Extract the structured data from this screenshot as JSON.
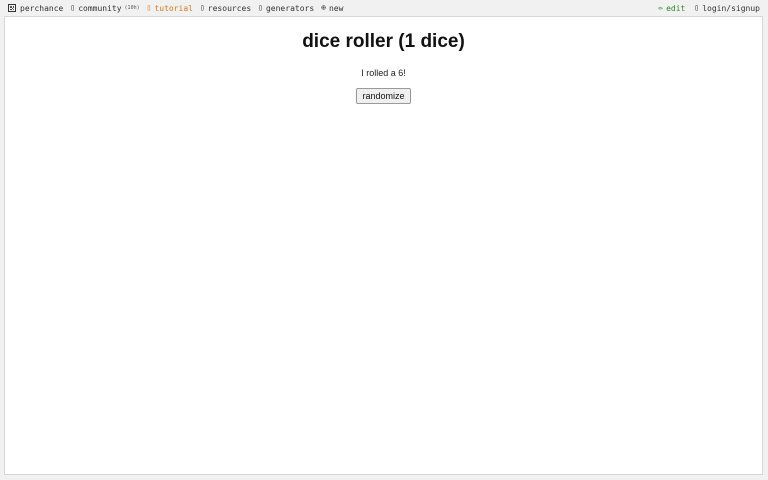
{
  "nav": {
    "left": [
      {
        "label": "perchance",
        "icon": "dice-logo-icon"
      },
      {
        "label": "community",
        "icon": "people-icon",
        "count": "(10h)"
      },
      {
        "label": "tutorial",
        "icon": "book-icon"
      },
      {
        "label": "resources",
        "icon": "box-icon"
      },
      {
        "label": "generators",
        "icon": "list-icon"
      },
      {
        "label": "new",
        "icon": "plus-circle-icon"
      }
    ],
    "right": [
      {
        "label": "edit",
        "icon": "pencil-icon"
      },
      {
        "label": "login/signup",
        "icon": "user-icon"
      }
    ]
  },
  "colors": {
    "tutorial": "#d67a1a",
    "edit": "#2e8a2e"
  },
  "main": {
    "title": "dice roller (1 dice)",
    "result": "I rolled a 6!",
    "button_label": "randomize"
  }
}
